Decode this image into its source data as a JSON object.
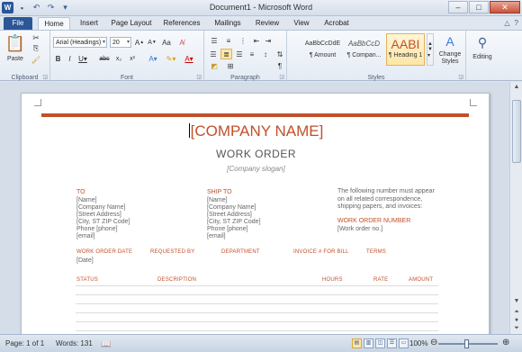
{
  "window": {
    "title": "Document1 - Microsoft Word",
    "logo": "W"
  },
  "tabs": [
    {
      "label": "File"
    },
    {
      "label": "Home"
    },
    {
      "label": "Insert"
    },
    {
      "label": "Page Layout"
    },
    {
      "label": "References"
    },
    {
      "label": "Mailings"
    },
    {
      "label": "Review"
    },
    {
      "label": "View"
    },
    {
      "label": "Acrobat"
    }
  ],
  "ribbon": {
    "clipboard": {
      "label": "Clipboard",
      "paste": "Paste"
    },
    "font": {
      "label": "Font",
      "name": "Arial (Headings)",
      "size": "20"
    },
    "paragraph": {
      "label": "Paragraph"
    },
    "styles": {
      "label": "Styles",
      "items": [
        {
          "preview": "AaBbCcDdE",
          "name": "¶ Amount"
        },
        {
          "preview": "AaBbCcD",
          "name": "¶ Compan..."
        },
        {
          "preview": "AABI",
          "name": "¶ Heading 1"
        }
      ],
      "change": "Change Styles"
    },
    "editing": {
      "label": "Editing"
    }
  },
  "document": {
    "company": "[COMPANY NAME]",
    "heading": "WORK ORDER",
    "slogan": "[Company slogan]",
    "to": {
      "title": "TO",
      "lines": [
        "[Name]",
        "[Company Name]",
        "[Street Address]",
        "[City, ST  ZIP Code]",
        "Phone [phone]",
        "[email]"
      ]
    },
    "ship_to": {
      "title": "SHIP TO",
      "lines": [
        "[Name]",
        "[Company Name]",
        "[Street Address]",
        "[City, ST  ZIP Code]",
        "Phone [phone]",
        "[email]"
      ]
    },
    "note": "The following number must appear on all related correspondence, shipping papers, and invoices:",
    "work_order_number": {
      "title": "WORK ORDER NUMBER",
      "value": "[Work order no.]"
    },
    "columns1": [
      "WORK ORDER DATE",
      "REQUESTED BY",
      "DEPARTMENT",
      "INVOICE # FOR BILL",
      "TERMS"
    ],
    "date": "[Date]",
    "columns2": [
      "STATUS",
      "DESCRIPTION",
      "HOURS",
      "RATE",
      "AMOUNT"
    ]
  },
  "status": {
    "page": "Page: 1 of 1",
    "words": "Words: 131",
    "zoom": "100%"
  }
}
